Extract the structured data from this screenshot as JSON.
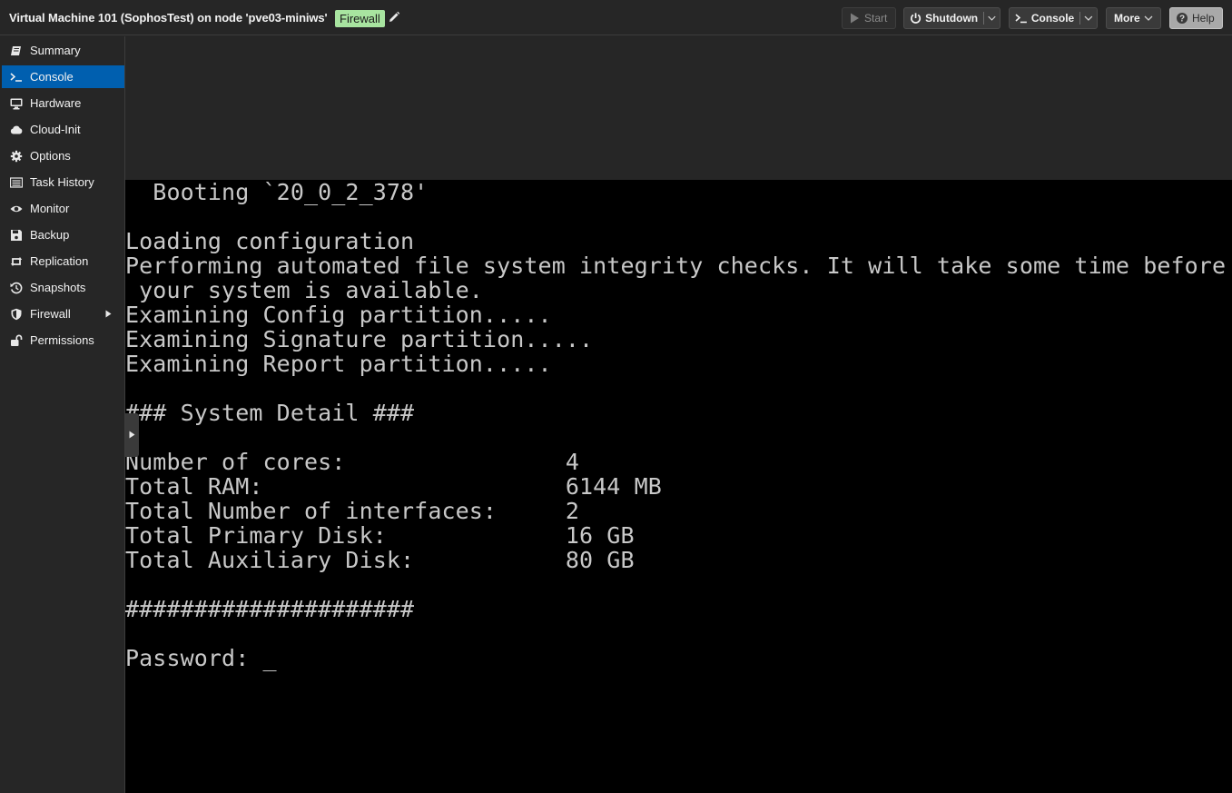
{
  "header": {
    "title": "Virtual Machine 101 (SophosTest) on node 'pve03-miniws'",
    "tag": "Firewall",
    "buttons": {
      "start": "Start",
      "shutdown": "Shutdown",
      "console": "Console",
      "more": "More",
      "help": "Help"
    }
  },
  "sidebar": {
    "items": [
      {
        "label": "Summary",
        "icon": "book-icon"
      },
      {
        "label": "Console",
        "icon": "terminal-icon",
        "active": true
      },
      {
        "label": "Hardware",
        "icon": "monitor-icon"
      },
      {
        "label": "Cloud-Init",
        "icon": "cloud-icon"
      },
      {
        "label": "Options",
        "icon": "gear-icon"
      },
      {
        "label": "Task History",
        "icon": "list-icon"
      },
      {
        "label": "Monitor",
        "icon": "eye-icon"
      },
      {
        "label": "Backup",
        "icon": "floppy-icon"
      },
      {
        "label": "Replication",
        "icon": "retweet-icon"
      },
      {
        "label": "Snapshots",
        "icon": "history-icon"
      },
      {
        "label": "Firewall",
        "icon": "shield-icon"
      },
      {
        "label": "Permissions",
        "icon": "unlock-icon"
      }
    ]
  },
  "console": {
    "lines": [
      "  Booting `20_0_2_378'",
      "",
      "Loading configuration",
      "Performing automated file system integrity checks. It will take some time before",
      " your system is available.",
      "Examining Config partition.....",
      "Examining Signature partition.....",
      "Examining Report partition.....",
      "",
      "### System Detail ###",
      "",
      "Number of cores:                4",
      "Total RAM:                      6144 MB",
      "Total Number of interfaces:     2",
      "Total Primary Disk:             16 GB",
      "Total Auxiliary Disk:           80 GB",
      "",
      "#####################",
      "",
      "Password: _"
    ]
  },
  "colors": {
    "accent": "#005faf",
    "tag_bg": "#a8e4a0",
    "console_bg": "#000000",
    "console_text": "#c8c8c8"
  }
}
